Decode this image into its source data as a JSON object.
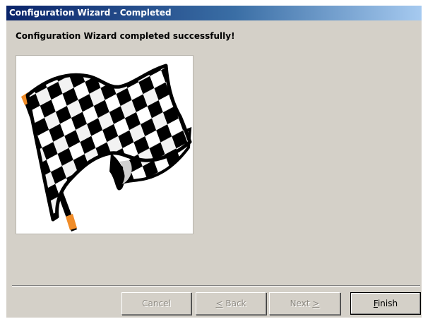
{
  "window": {
    "title": "Configuration Wizard - Completed"
  },
  "page": {
    "heading": "Configuration Wizard completed successfully!",
    "image": "checkered-flag"
  },
  "buttons": {
    "cancel": "Cancel",
    "back": {
      "mnemonic": "<",
      "rest": " Back"
    },
    "next": {
      "pre": "Next ",
      "mnemonic": ">"
    },
    "finish": {
      "mnemonic": "F",
      "rest": "inish"
    }
  },
  "colors": {
    "titlebar_start": "#0a246a",
    "titlebar_end": "#a6caf0",
    "dialog_face": "#d4d0c8",
    "pole_tip": "#f08c28"
  }
}
